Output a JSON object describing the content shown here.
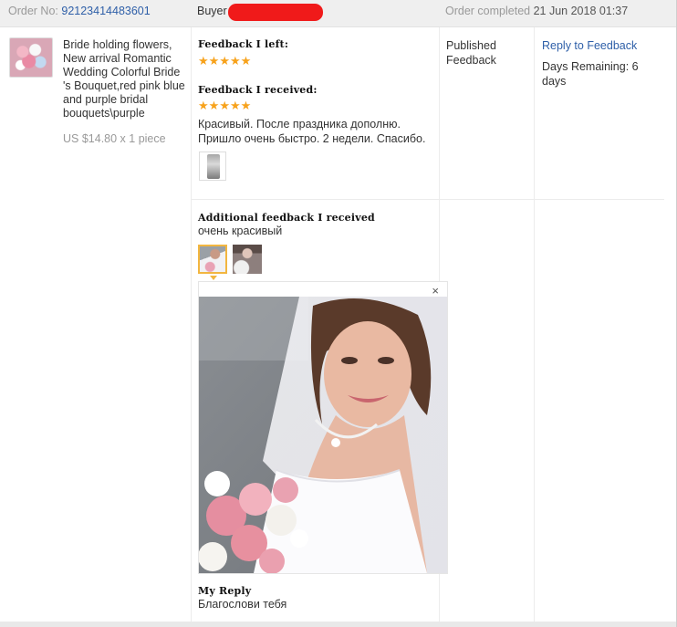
{
  "header": {
    "order_label": "Order No:",
    "order_number": "92123414483601",
    "buyer_label": "Buyer",
    "completed_label": "Order completed",
    "completed_date": "21 Jun 2018 01:37"
  },
  "product": {
    "title": "Bride holding flowers, New arrival Romantic Wedding Colorful Bride 's Bouquet,red pink blue and purple bridal bouquets\\purple",
    "price": "US $14.80 x 1 piece"
  },
  "feedback": {
    "left_label": "Feedback I left:",
    "left_stars": 5,
    "received_label": "Feedback I received:",
    "received_stars": 5,
    "received_text": "Красивый. После праздника дополню. Пришло очень быстро. 2 недели. Спасибо.",
    "status": "Published Feedback",
    "reply_link": "Reply to Feedback",
    "days_remaining": "Days Remaining: 6 days"
  },
  "additional": {
    "label": "Additional feedback I received",
    "text": "очень красивый",
    "close_symbol": "×"
  },
  "reply": {
    "label": "My Reply",
    "text": "Благослови тебя"
  },
  "icons": {
    "star": "star-icon",
    "close": "close-icon"
  },
  "colors": {
    "link": "#2e5fa8",
    "star": "#f7a21b",
    "redaction": "#f01a1a",
    "selected_thumb": "#f2b640"
  }
}
